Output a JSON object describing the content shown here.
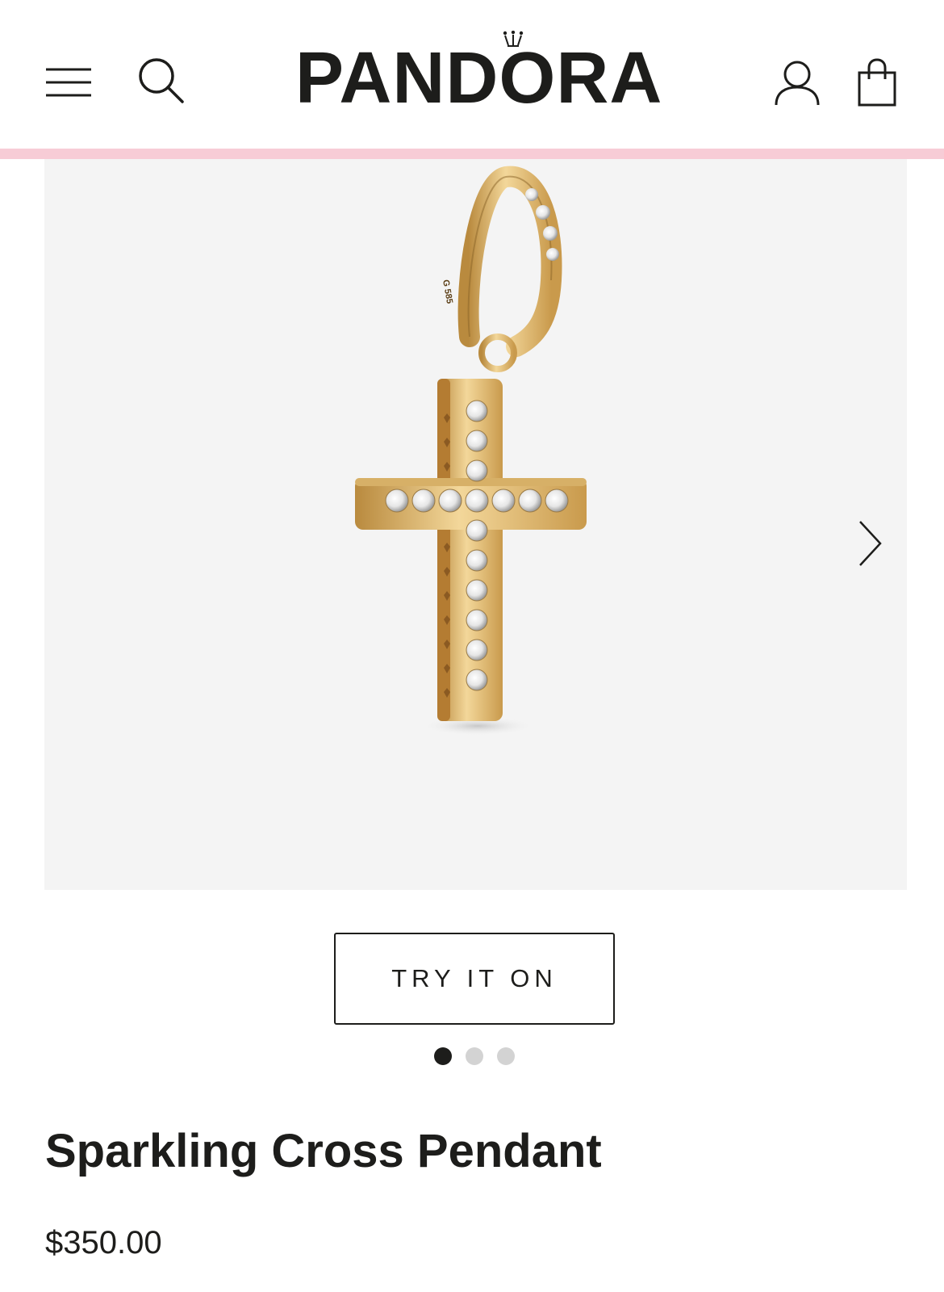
{
  "header": {
    "brand": "PANDORA",
    "icons": {
      "menu": "hamburger-menu-icon",
      "search": "search-icon",
      "account": "user-icon",
      "bag": "shopping-bag-icon"
    },
    "accent_bar_color": "#f7ccd6"
  },
  "gallery": {
    "background": "#f4f4f4",
    "image_alt": "gold cross pendant with clear stones",
    "engraving": "G 585",
    "next_icon": "chevron-right-icon",
    "total_slides": 3,
    "active_slide": 1
  },
  "product": {
    "try_on_label": "TRY IT ON",
    "title": "Sparkling Cross Pendant",
    "price": "$350.00"
  }
}
